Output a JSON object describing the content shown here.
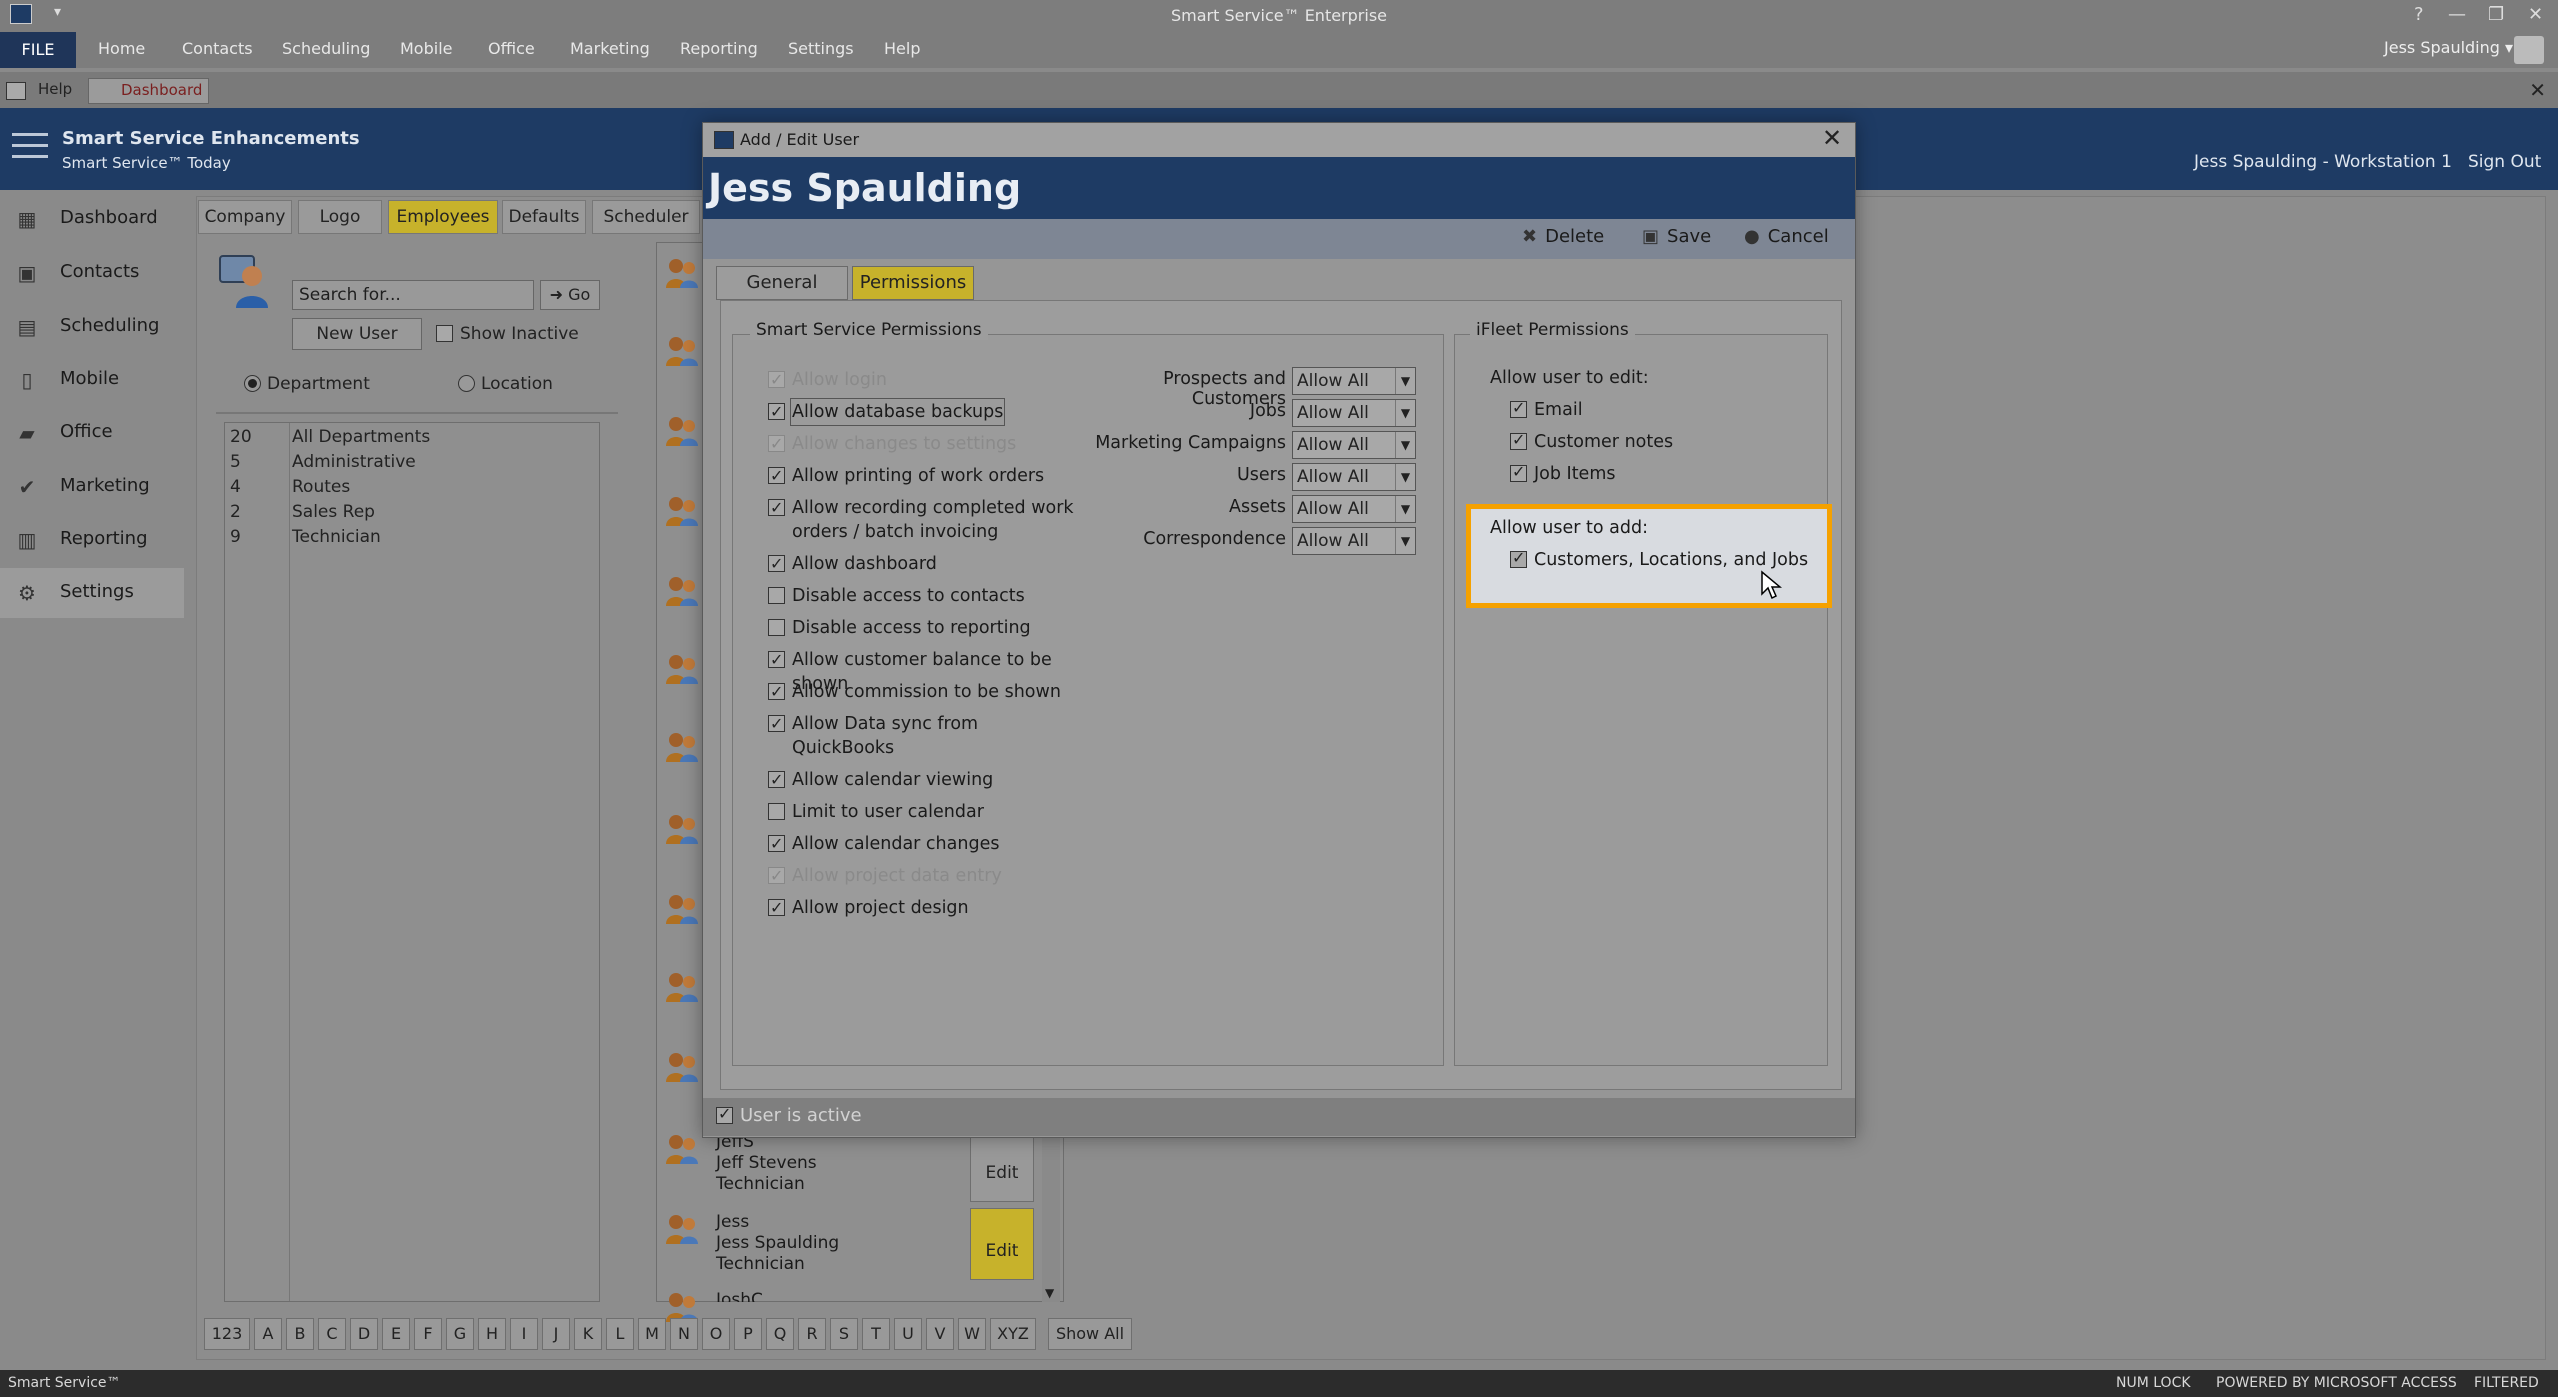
{
  "app": {
    "title": "Smart Service™ Enterprise",
    "quick_access": "▾",
    "window_controls": [
      "?",
      "—",
      "❐",
      "✕"
    ]
  },
  "menu": {
    "file": "FILE",
    "items": [
      "Home",
      "Contacts",
      "Scheduling",
      "Mobile",
      "Office",
      "Marketing",
      "Reporting",
      "Settings",
      "Help"
    ],
    "user": "Jess Spaulding ▾"
  },
  "doc_tabs": [
    "Help",
    "Dashboard"
  ],
  "header": {
    "brand_line1": "Smart Service Enhancements",
    "brand_line2": "Smart Service™ Today",
    "user_info": "Jess Spaulding  -  Workstation 1",
    "sign_out": "Sign Out"
  },
  "nav": [
    {
      "label": "Dashboard",
      "icon": "dashboard-icon",
      "glyph": "▦"
    },
    {
      "label": "Contacts",
      "icon": "contacts-icon",
      "glyph": "▣"
    },
    {
      "label": "Scheduling",
      "icon": "calendar-icon",
      "glyph": "▤"
    },
    {
      "label": "Mobile",
      "icon": "mobile-icon",
      "glyph": "▯"
    },
    {
      "label": "Office",
      "icon": "briefcase-icon",
      "glyph": "▰"
    },
    {
      "label": "Marketing",
      "icon": "check-circle-icon",
      "glyph": "✔"
    },
    {
      "label": "Reporting",
      "icon": "clipboard-icon",
      "glyph": "▥"
    },
    {
      "label": "Settings",
      "icon": "gear-icon",
      "glyph": "⚙"
    }
  ],
  "settings_tabs": [
    "Company",
    "Logo",
    "Employees",
    "Defaults",
    "Scheduler"
  ],
  "employees": {
    "search_placeholder": "Search for...",
    "go": "➜ Go",
    "new_user": "New User",
    "show_inactive": "Show Inactive",
    "opt_department": "Department",
    "opt_location": "Location",
    "departments": [
      {
        "count": "20",
        "name": "All Departments"
      },
      {
        "count": "5",
        "name": "Administrative"
      },
      {
        "count": "4",
        "name": "Routes"
      },
      {
        "count": "2",
        "name": "Sales Rep"
      },
      {
        "count": "9",
        "name": "Technician"
      }
    ],
    "list": [
      {
        "lines": [
          "JeffS",
          "Jeff Stevens",
          "Technician"
        ],
        "edit": "Edit"
      },
      {
        "lines": [
          "Jess",
          "Jess Spaulding",
          "Technician"
        ],
        "edit": "Edit"
      },
      {
        "lines": [
          "JoshC",
          "",
          ""
        ],
        "edit": ""
      }
    ]
  },
  "alphabet": [
    "123",
    "A",
    "B",
    "C",
    "D",
    "E",
    "F",
    "G",
    "H",
    "I",
    "J",
    "K",
    "L",
    "M",
    "N",
    "O",
    "P",
    "Q",
    "R",
    "S",
    "T",
    "U",
    "V",
    "W",
    "XYZ",
    "Show All"
  ],
  "status": {
    "left": "Smart Service™",
    "num_lock": "NUM LOCK",
    "powered": "POWERED BY MICROSOFT ACCESS",
    "filtered": "FILTERED"
  },
  "modal": {
    "title": "Add / Edit User",
    "user_name": "Jess Spaulding",
    "delete": "Delete",
    "save": "Save",
    "cancel": "Cancel",
    "tabs": [
      "General",
      "Permissions"
    ],
    "ss_group": "Smart Service Permissions",
    "fleet_group": "iFleet Permissions",
    "permissions": [
      {
        "label": "Allow login",
        "checked": true,
        "disabled": true
      },
      {
        "label": "Allow database backups",
        "checked": true,
        "disabled": false
      },
      {
        "label": "Allow changes to settings",
        "checked": true,
        "disabled": true
      },
      {
        "label": "Allow printing of work orders",
        "checked": true,
        "disabled": false
      },
      {
        "label": "Allow recording completed work orders / batch invoicing",
        "checked": true,
        "disabled": false
      },
      {
        "label": "Allow dashboard",
        "checked": true,
        "disabled": false
      },
      {
        "label": "Disable access to contacts",
        "checked": false,
        "disabled": false
      },
      {
        "label": "Disable access to reporting",
        "checked": false,
        "disabled": false
      },
      {
        "label": "Allow customer balance to be shown",
        "checked": true,
        "disabled": false
      },
      {
        "label": "Allow commission to be shown",
        "checked": true,
        "disabled": false
      },
      {
        "label": "Allow Data sync from QuickBooks",
        "checked": true,
        "disabled": false
      },
      {
        "label": "Allow calendar viewing",
        "checked": true,
        "disabled": false
      },
      {
        "label": "Limit to user calendar",
        "checked": false,
        "disabled": false
      },
      {
        "label": "Allow calendar changes",
        "checked": true,
        "disabled": false
      },
      {
        "label": "Allow project data entry",
        "checked": true,
        "disabled": true
      },
      {
        "label": "Allow project design",
        "checked": true,
        "disabled": false
      }
    ],
    "selects": [
      {
        "label": "Prospects and Customers",
        "value": "Allow All"
      },
      {
        "label": "Jobs",
        "value": "Allow All"
      },
      {
        "label": "Marketing Campaigns",
        "value": "Allow All"
      },
      {
        "label": "Users",
        "value": "Allow All"
      },
      {
        "label": "Assets",
        "value": "Allow All"
      },
      {
        "label": "Correspondence",
        "value": "Allow All"
      }
    ],
    "fleet_edit_label": "Allow user to edit:",
    "fleet_edit": [
      {
        "label": "Email",
        "checked": true
      },
      {
        "label": "Customer notes",
        "checked": true
      },
      {
        "label": "Job Items",
        "checked": true
      }
    ],
    "fleet_add_label": "Allow user to add:",
    "fleet_add": [
      {
        "label": "Customers, Locations, and Jobs",
        "checked": true
      }
    ],
    "user_active": "User is active",
    "highlight_color": "#f5a100"
  },
  "colors": {
    "header_blue": "#1e3b64",
    "active_tab": "#c7b22b",
    "highlight": "#f5a100"
  }
}
